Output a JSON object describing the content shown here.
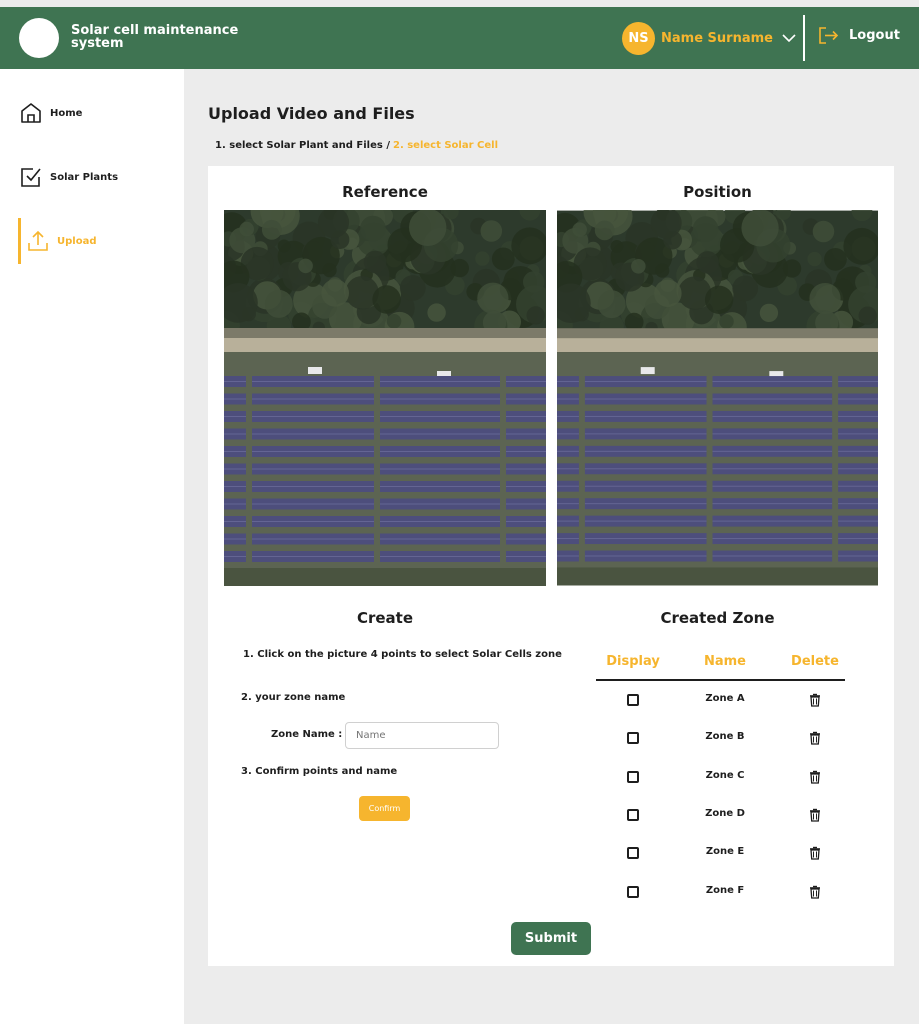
{
  "app": {
    "title": "Solar cell maintenance system",
    "brand_color": "#3f7452",
    "accent_color": "#f6b52e"
  },
  "user": {
    "initials": "NS",
    "name": "Name Surname",
    "logout_label": "Logout"
  },
  "sidebar": {
    "items": [
      {
        "label": "Home",
        "icon": "home-icon",
        "active": false
      },
      {
        "label": "Solar Plants",
        "icon": "checkbox-icon",
        "active": false
      },
      {
        "label": "Upload",
        "icon": "upload-icon",
        "active": true
      }
    ]
  },
  "main": {
    "title": "Upload Video and Files",
    "breadcrumb": {
      "step1": "1. select Solar Plant and Files /",
      "step2": "2. select Solar Cell"
    },
    "reference_heading": "Reference",
    "position_heading": "Position",
    "create": {
      "heading": "Create",
      "step1": "1. Click on the picture 4 points to select Solar Cells zone",
      "step2": "2. your zone name",
      "zone_name_label": "Zone Name :",
      "zone_name_placeholder": "Name",
      "step3": "3. Confirm points and name",
      "confirm_label": "Confirm"
    },
    "created_zone": {
      "heading": "Created Zone",
      "columns": [
        "Display",
        "Name",
        "Delete"
      ],
      "rows": [
        {
          "name": "Zone A",
          "display": false
        },
        {
          "name": "Zone B",
          "display": false
        },
        {
          "name": "Zone C",
          "display": false
        },
        {
          "name": "Zone D",
          "display": false
        },
        {
          "name": "Zone E",
          "display": false
        },
        {
          "name": "Zone F",
          "display": false
        }
      ]
    },
    "submit_label": "Submit"
  }
}
